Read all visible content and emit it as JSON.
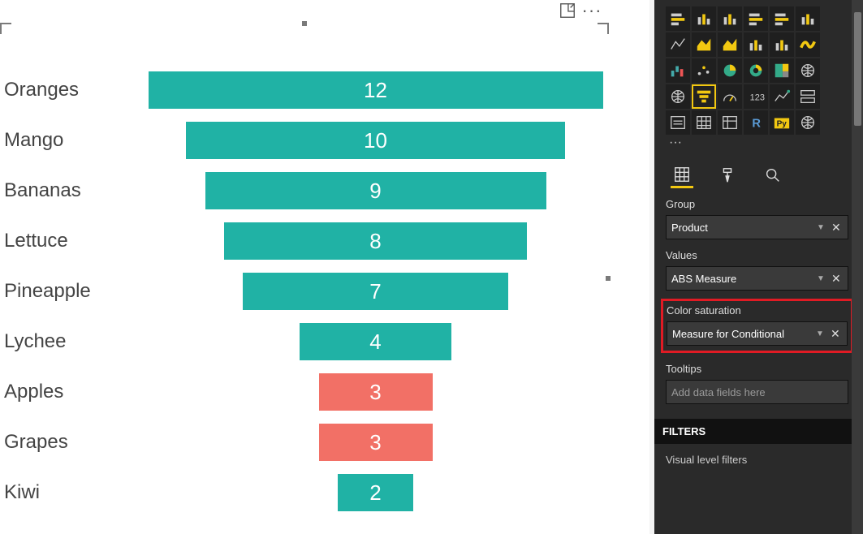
{
  "chart_data": {
    "type": "bar",
    "orientation": "funnel",
    "categories": [
      "Oranges",
      "Mango",
      "Bananas",
      "Lettuce",
      "Pineapple",
      "Lychee",
      "Apples",
      "Grapes",
      "Kiwi"
    ],
    "values": [
      12,
      10,
      9,
      8,
      7,
      4,
      3,
      3,
      2
    ],
    "colors": [
      "#20b2a5",
      "#20b2a5",
      "#20b2a5",
      "#20b2a5",
      "#20b2a5",
      "#20b2a5",
      "#f27066",
      "#f27066",
      "#20b2a5"
    ],
    "title": "",
    "xlabel": "",
    "ylabel": "",
    "value_max": 12
  },
  "vis_pane": {
    "tabs": {
      "fields": "Fields",
      "format": "Format",
      "analytics": "Analytics"
    },
    "group": {
      "label": "Group",
      "value": "Product"
    },
    "values": {
      "label": "Values",
      "value": "ABS Measure"
    },
    "color_sat": {
      "label": "Color saturation",
      "value": "Measure for Conditional"
    },
    "tooltips": {
      "label": "Tooltips",
      "placeholder": "Add data fields here"
    },
    "filters_header": "FILTERS",
    "visual_filters": "Visual level filters"
  },
  "gallery_icons": [
    "bar-stacked",
    "column-stacked",
    "column-clustered",
    "bar-clustered",
    "bar-100",
    "column-100",
    "line",
    "area",
    "area-stacked",
    "line-column",
    "line-column-clustered",
    "ribbon",
    "waterfall",
    "scatter",
    "pie",
    "donut",
    "treemap",
    "map-globe",
    "filled-map",
    "funnel",
    "gauge",
    "card",
    "kpi",
    "multi-card",
    "slicer",
    "table",
    "matrix",
    "r-visual",
    "py-visual",
    "arcgis"
  ],
  "py_label": "Py",
  "r_label": "R"
}
